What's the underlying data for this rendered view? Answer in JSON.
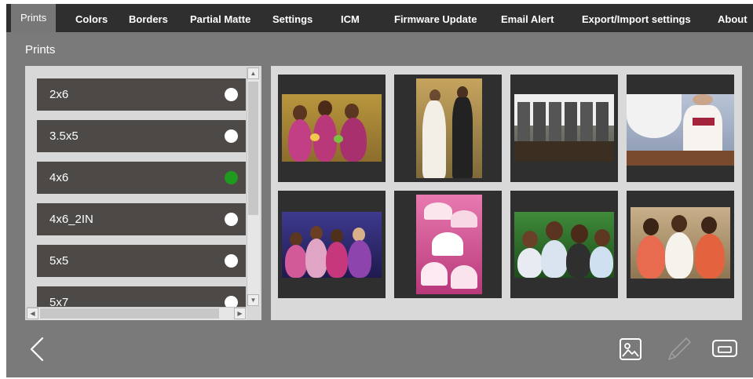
{
  "tabs": [
    "Prints",
    "Colors",
    "Borders",
    "Partial Matte",
    "Settings",
    "ICM",
    "Firmware Update",
    "Email Alert",
    "Export/Import settings",
    "About"
  ],
  "section_title": "Prints",
  "print_sizes": [
    {
      "label": "2x6",
      "selected": false
    },
    {
      "label": "3.5x5",
      "selected": false
    },
    {
      "label": "4x6",
      "selected": true
    },
    {
      "label": "4x6_2IN",
      "selected": false
    },
    {
      "label": "5x5",
      "selected": false
    },
    {
      "label": "5x7",
      "selected": false
    }
  ],
  "colors": {
    "selected_radio": "#1f9a1f",
    "tab_bar": "#2f2f2f",
    "list_item": "#4d4947"
  },
  "icons": [
    "back-arrow-icon",
    "image-icon",
    "pencil-icon",
    "printer-icon"
  ],
  "thumbnails": [
    "photo-bridesmaids-1",
    "photo-couple",
    "photo-groomsmen",
    "photo-bride-back",
    "photo-party-group",
    "photo-cupcakes",
    "photo-family",
    "photo-bridesmaids-2"
  ]
}
